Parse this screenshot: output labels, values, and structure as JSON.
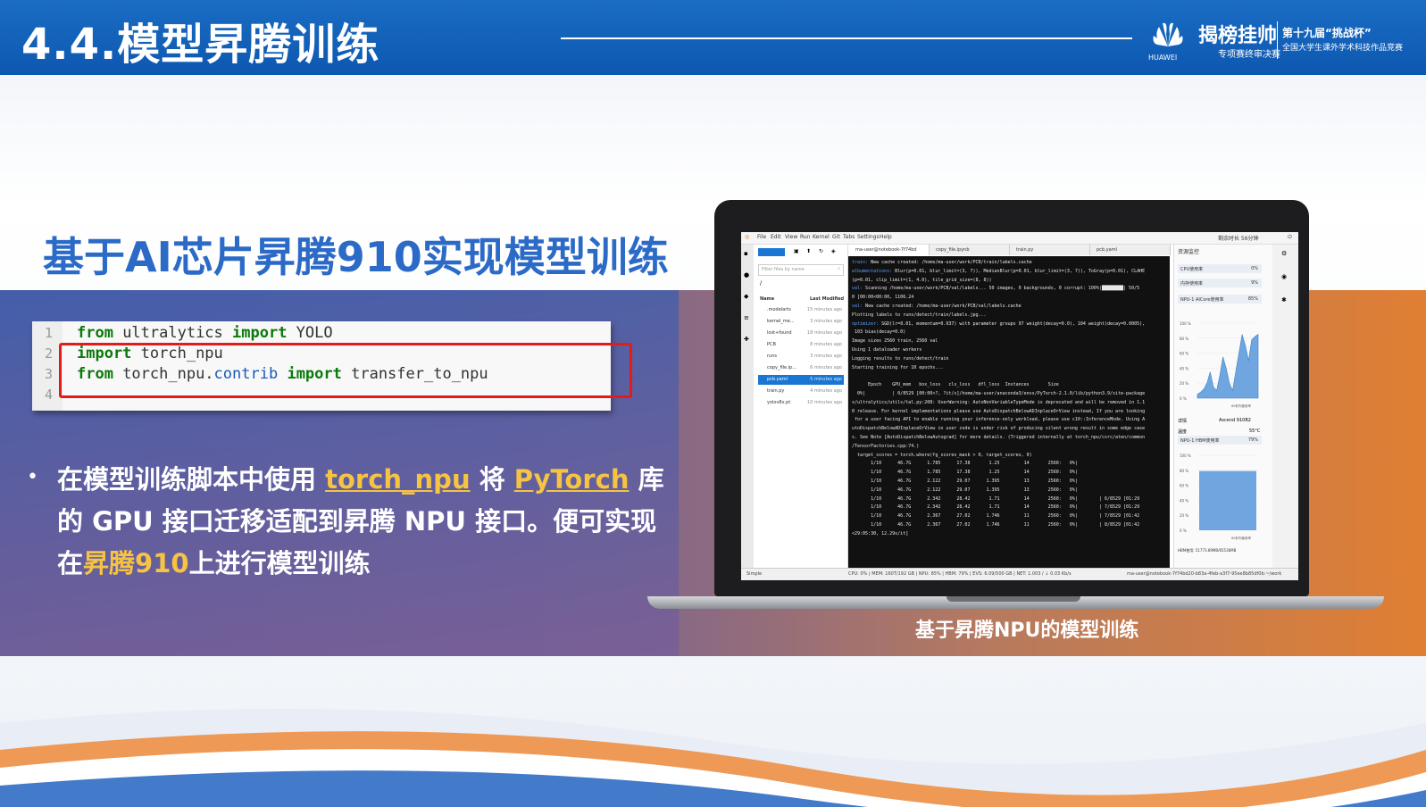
{
  "header": {
    "title": "4.4.模型昇腾训练",
    "huawei_label": "HUAWEI",
    "brand1": "揭榜挂帅",
    "brand1_sub": "专项赛终审决赛",
    "brand2": "第十九届“挑战杯”",
    "brand2_sub": "全国大学生课外学术科技作品竞赛"
  },
  "subtitle": "基于AI芯片昇腾910实现模型训练",
  "code": {
    "line_numbers": [
      "1",
      "2",
      "3",
      "4"
    ],
    "line1": {
      "kw1": "from",
      "mod": " ultralytics ",
      "kw2": "import",
      "rest": " YOLO"
    },
    "line2": {
      "kw1": "import",
      "rest": " torch_npu"
    },
    "line3": {
      "kw1": "from",
      "mod": " torch_npu.",
      "attr": "contrib",
      "sp": " ",
      "kw2": "import",
      "rest": " transfer_to_npu"
    }
  },
  "bullet": "•",
  "paragraph": {
    "p1": "在模型训练脚本中使用 ",
    "h1": "torch_npu",
    "p2": " 将 ",
    "h2": "PyTorch",
    "p3": " 库的 GPU 接口迁移适配到昇腾 NPU 接口。便可实现在",
    "h3": "昇腾910",
    "p4": "上进行模型训练"
  },
  "caption": "基于昇腾NPU的模型训练",
  "ide": {
    "menu": [
      "File",
      "Edit",
      "View",
      "Run",
      "Kernel",
      "Git",
      "Tabs",
      "Settings",
      "Help"
    ],
    "search_placeholder": "Filter files by name",
    "col_name": "Name",
    "col_modified": "Last Modified",
    "breadcrumb": "/",
    "files": [
      {
        "name": ".modelarts",
        "time": "15 minutes ago"
      },
      {
        "name": "kernel_me...",
        "time": "3 minutes ago"
      },
      {
        "name": "lost+found",
        "time": "18 minutes ago"
      },
      {
        "name": "PCB",
        "time": "8 minutes ago"
      },
      {
        "name": "runs",
        "time": "3 minutes ago"
      },
      {
        "name": "copy_file.ip...",
        "time": "6 minutes ago"
      },
      {
        "name": "pcb.yaml",
        "time": "5 minutes ago"
      },
      {
        "name": "train.py",
        "time": "4 minutes ago"
      },
      {
        "name": "yolov8x.pt",
        "time": "10 minutes ago"
      }
    ],
    "tabs": [
      "ma-user@notebook-7f74bd",
      "copy_file.ipynb",
      "train.py",
      "pcb.yaml"
    ],
    "terminal": [
      "train: New cache created: /home/ma-user/work/PCB/train/labels.cache",
      "albumentations: Blur(p=0.01, blur_limit=(3, 7)), MedianBlur(p=0.01, blur_limit=(3, 7)), ToGray(p=0.01), CLAHE",
      "(p=0.01, clip_limit=(1, 4.0), tile_grid_size=(8, 8))",
      "val: Scanning /home/ma-user/work/PCB/val/labels... 50 images, 0 backgrounds, 0 corrupt: 100%|████████| 50/5",
      "0 [00:00<00:00, 1106.24",
      "val: New cache created: /home/ma-user/work/PCB/val/labels.cache",
      "Plotting labels to runs/detect/train/labels.jpg...",
      "optimizer: SGD(lr=0.01, momentum=0.937) with parameter groups 97 weight(decay=0.0), 104 weight(decay=0.0005),",
      " 103 bias(decay=0.0)",
      "Image sizes 2560 train, 2560 val",
      "Using 1 dataloader workers",
      "Logging results to runs/detect/train",
      "Starting training for 10 epochs...",
      "",
      "      Epoch    GPU_mem   box_loss   cls_loss   dfl_loss  Instances       Size",
      "  0%|          | 0/8529 [00:00<?, ?it/s]/home/ma-user/anaconda3/envs/PyTorch-2.1.0/lib/python3.9/site-package",
      "s/ultralytics/utils/tal.py:208: UserWarning: AutoNonVariableTypeMode is deprecated and will be removed in 1.1",
      "0 release. For kernel implementations please use AutoDispatchBelowADInplaceOrView instead, If you are looking",
      " for a user facing API to enable running your inference-only workload, please use c10::InferenceMode. Using A",
      "utoDispatchBelowADInplaceOrView in user code is under risk of producing silent wrong result in some edge case",
      "s. See Note [AutoDispatchBelowAutograd] for more details. (Triggered internally at torch_npu/csrc/aten/common",
      "/TensorFactories.cpp:74.)",
      "  target_scores = torch.where(fg_scores_mask > 0, target_scores, 0)",
      "       1/10      46.7G      1.785      17.38       1.25         14       2560:   0%|",
      "       1/10      46.7G      1.785      17.38       1.25         14       2560:   0%|",
      "       1/10      46.7G      2.122      29.07      1.395         13       2560:   0%|",
      "       1/10      46.7G      2.122      29.07      1.395         13       2560:   0%|",
      "       1/10      46.7G      2.342      28.42       1.71         14       2560:   0%|        | 6/8529 [01:29",
      "       1/10      46.7G      2.342      28.42       1.71         14       2560:   0%|        | 7/8529 [01:29",
      "       1/10      46.7G      2.367      27.02      1.746         11       2560:   0%|        | 7/8529 [01:42",
      "       1/10      46.7G      2.367      27.02      1.746         11       2560:   0%|        | 8/8529 [01:42",
      "<29:05:30, 12.29s/it]"
    ],
    "monitor": {
      "title": "资源监控",
      "cpu_label": "CPU使用率",
      "cpu_val": "0%",
      "mem_label": "内存使用率",
      "mem_val": "9%",
      "npu_label": "NPU-1 AICore使用率",
      "npu_val": "85%",
      "axis": [
        "100 %",
        "80 %",
        "60 %",
        "40 %",
        "20 %",
        "0 %"
      ],
      "time_label": "60秒内使用率",
      "spec_label": "详情",
      "spec_val": "Ascend 910B2",
      "temp_label": "温度",
      "temp_val": "55°C",
      "hbm_label": "NPU-1 HBM使用率",
      "hbm_val": "79%",
      "hbm_value": "HBM使用: 51773.89MB/65536MB"
    },
    "status_left": "Simple",
    "status_mid": "CPU: 0% | MEM: 160T/192 GB | NPU: 85% | HBM: 79% | EVS: 6.09/500 GB | NET: 1.003 / ↓ 0.03 Kb/s",
    "status_right": "ma-user@notebook-7f74bd20-b83a-4feb-a3f7-95ee8b85df0b:~/work",
    "corner_text": "剩余时长 56分钟",
    "npu_chart_pct": [
      5,
      8,
      12,
      20,
      35,
      15,
      10,
      30,
      55,
      40,
      20,
      10,
      35,
      60,
      85,
      70,
      50,
      78,
      82,
      85
    ],
    "hbm_chart_pct": [
      79
    ]
  }
}
